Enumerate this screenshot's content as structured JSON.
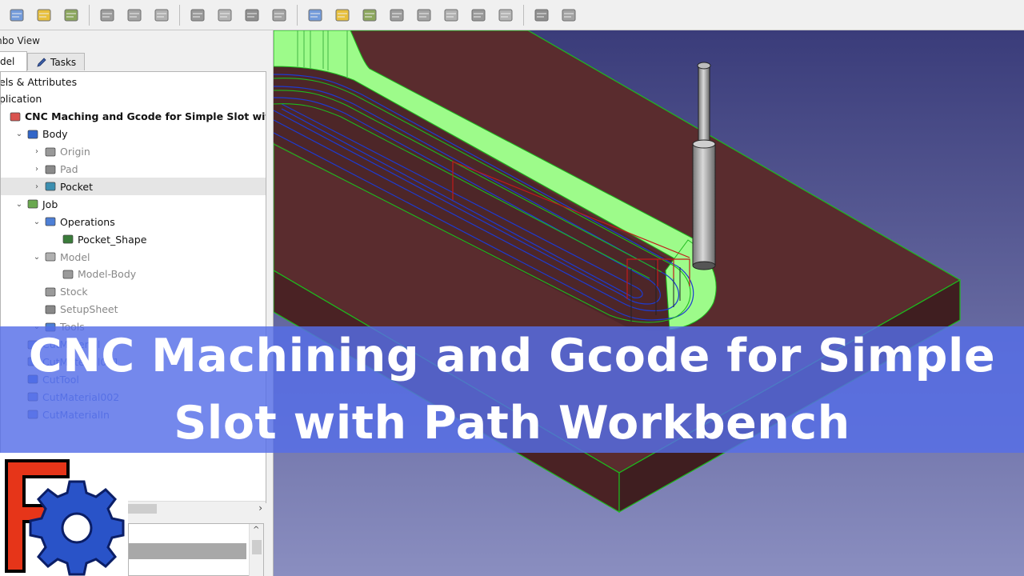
{
  "toolbar": {
    "icons": [
      "part-icon",
      "macro-icon",
      "view-icon",
      "path-job-icon",
      "path-post-icon",
      "path-sanity-icon",
      "path-inspect-icon",
      "path-simulator-icon",
      "path-tool-icon",
      "path-profile-icon",
      "path-pocket-icon",
      "path-adaptive-icon",
      "path-face-icon",
      "path-helix-icon",
      "path-engrave-icon",
      "path-dressup-icon",
      "path-drilling-icon",
      "path-3d-pocket-icon",
      "path-surface-icon",
      "path-waterline-icon"
    ]
  },
  "combo_view": {
    "title": "mbo View",
    "tabs": [
      {
        "label": "del",
        "active": true
      },
      {
        "label": "Tasks",
        "active": false
      }
    ]
  },
  "tree": [
    {
      "label": "els & Attributes",
      "indent": 0,
      "icon": "none",
      "arrow": "",
      "state": "normal"
    },
    {
      "label": "plication",
      "indent": 0,
      "icon": "none",
      "arrow": "",
      "state": "normal"
    },
    {
      "label": "CNC Maching and Gcode for Simple Slot with Path",
      "indent": 0,
      "icon": "document-icon",
      "arrow": "",
      "state": "bold"
    },
    {
      "label": "Body",
      "indent": 1,
      "icon": "body-icon",
      "arrow": "open",
      "state": "normal"
    },
    {
      "label": "Origin",
      "indent": 2,
      "icon": "origin-icon",
      "arrow": "closed",
      "state": "dim"
    },
    {
      "label": "Pad",
      "indent": 2,
      "icon": "pad-icon",
      "arrow": "closed",
      "state": "dim"
    },
    {
      "label": "Pocket",
      "indent": 2,
      "icon": "pocket-icon",
      "arrow": "closed",
      "state": "selected"
    },
    {
      "label": "Job",
      "indent": 1,
      "icon": "job-icon",
      "arrow": "open",
      "state": "normal"
    },
    {
      "label": "Operations",
      "indent": 2,
      "icon": "folder-icon",
      "arrow": "open",
      "state": "normal"
    },
    {
      "label": "Pocket_Shape",
      "indent": 3,
      "icon": "pocket-shape-icon",
      "arrow": "",
      "state": "normal"
    },
    {
      "label": "Model",
      "indent": 2,
      "icon": "folder-gray-icon",
      "arrow": "open",
      "state": "dim"
    },
    {
      "label": "Model-Body",
      "indent": 3,
      "icon": "model-body-icon",
      "arrow": "",
      "state": "dim"
    },
    {
      "label": "Stock",
      "indent": 2,
      "icon": "stock-icon",
      "arrow": "",
      "state": "dim"
    },
    {
      "label": "SetupSheet",
      "indent": 2,
      "icon": "setupsheet-icon",
      "arrow": "",
      "state": "dim"
    },
    {
      "label": "Tools",
      "indent": 2,
      "icon": "folder-icon",
      "arrow": "open",
      "state": "dim"
    },
    {
      "label": "CutMaterial",
      "indent": 1,
      "icon": "cutmaterial-icon",
      "arrow": "",
      "state": "link"
    },
    {
      "label": "CutMaterial001",
      "indent": 1,
      "icon": "cutmaterial-icon",
      "arrow": "",
      "state": "link"
    },
    {
      "label": "CutTool",
      "indent": 1,
      "icon": "cuttool-icon",
      "arrow": "",
      "state": "link"
    },
    {
      "label": "CutMaterial002",
      "indent": 1,
      "icon": "cutmaterial-icon",
      "arrow": "",
      "state": "link"
    },
    {
      "label": "CutMaterialIn",
      "indent": 1,
      "icon": "cutmaterial-icon",
      "arrow": "",
      "state": "link"
    }
  ],
  "banner": {
    "line1": "CNC Machining and Gcode for Simple",
    "line2": "Slot with Path Workbench"
  },
  "colors": {
    "stock_top": "#5a2c2e",
    "stock_side": "#4a2224",
    "wall_green": "#9dfb8a",
    "edge_green": "#1dbb1d",
    "toolpath_blue": "#1d3bd1",
    "rapid_red": "#c21a1a",
    "background_top": "#3a3c7a",
    "background_bottom": "#8a8ec0",
    "banner": "#566ee8"
  }
}
